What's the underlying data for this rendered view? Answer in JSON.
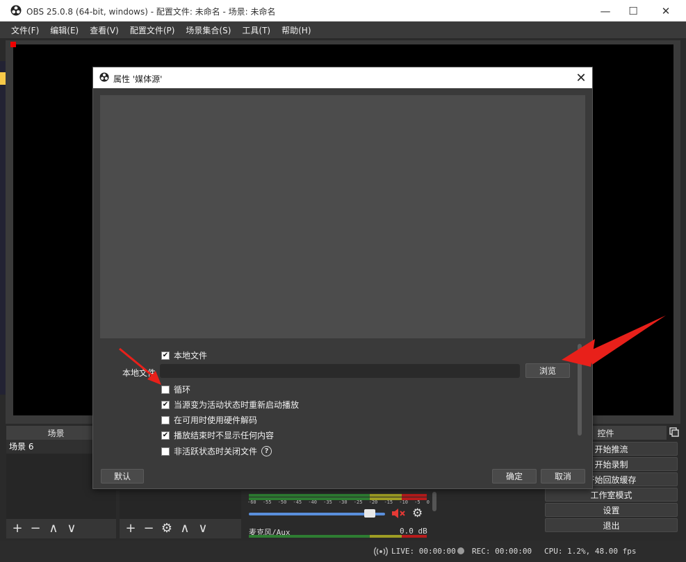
{
  "window": {
    "title": "OBS 25.0.8 (64-bit, windows) - 配置文件: 未命名 - 场景: 未命名",
    "controls": {
      "minimize": "—",
      "maximize": "☐",
      "close": "✕"
    }
  },
  "menu": [
    "文件(F)",
    "编辑(E)",
    "查看(V)",
    "配置文件(P)",
    "场景集合(S)",
    "工具(T)",
    "帮助(H)"
  ],
  "dialog": {
    "title": "属性 '媒体源'",
    "local_file_checkbox": {
      "label": "本地文件",
      "checked": "✔"
    },
    "local_file_label": "本地文件",
    "local_file_value": "",
    "browse_label": "浏览",
    "options": [
      {
        "label": "循环",
        "checked": ""
      },
      {
        "label": "当源变为活动状态时重新启动播放",
        "checked": "✔"
      },
      {
        "label": "在可用时使用硬件解码",
        "checked": ""
      },
      {
        "label": "播放结束时不显示任何内容",
        "checked": "✔"
      },
      {
        "label": "非活跃状态时关闭文件",
        "checked": ""
      }
    ],
    "help_glyph": "?",
    "default_label": "默认",
    "ok_label": "确定",
    "cancel_label": "取消"
  },
  "docks": {
    "scenes_title": "场景",
    "scene_item": "场景 6",
    "controls_title": "控件"
  },
  "toolbars": {
    "add": "+",
    "remove": "−",
    "up": "∧",
    "down": "∨",
    "settings": "⚙"
  },
  "mixer": {
    "ticks": [
      "-60",
      "-55",
      "-50",
      "-45",
      "-40",
      "-35",
      "-30",
      "-25",
      "-20",
      "-15",
      "-10",
      "-5",
      "0"
    ],
    "volume_level": 0.92,
    "channel_name": "麦克风/Aux",
    "level_db": "0.0 dB"
  },
  "controls": [
    "开始推流",
    "开始录制",
    "开始回放缓存",
    "工作室模式",
    "设置",
    "退出"
  ],
  "status": {
    "live": "LIVE: 00:00:00",
    "rec": "REC: 00:00:00",
    "cpu": "CPU: 1.2%, 48.00 fps"
  },
  "colors": {
    "accent_arrow": "#e8201a",
    "mute_red": "#e53935",
    "volume_blue": "#5a8fdc"
  },
  "icons": [
    "obs-logo-icon",
    "checkbox-icon",
    "help-icon",
    "mute-icon",
    "gear-icon",
    "float-icon",
    "live-icon",
    "record-dot-icon"
  ]
}
